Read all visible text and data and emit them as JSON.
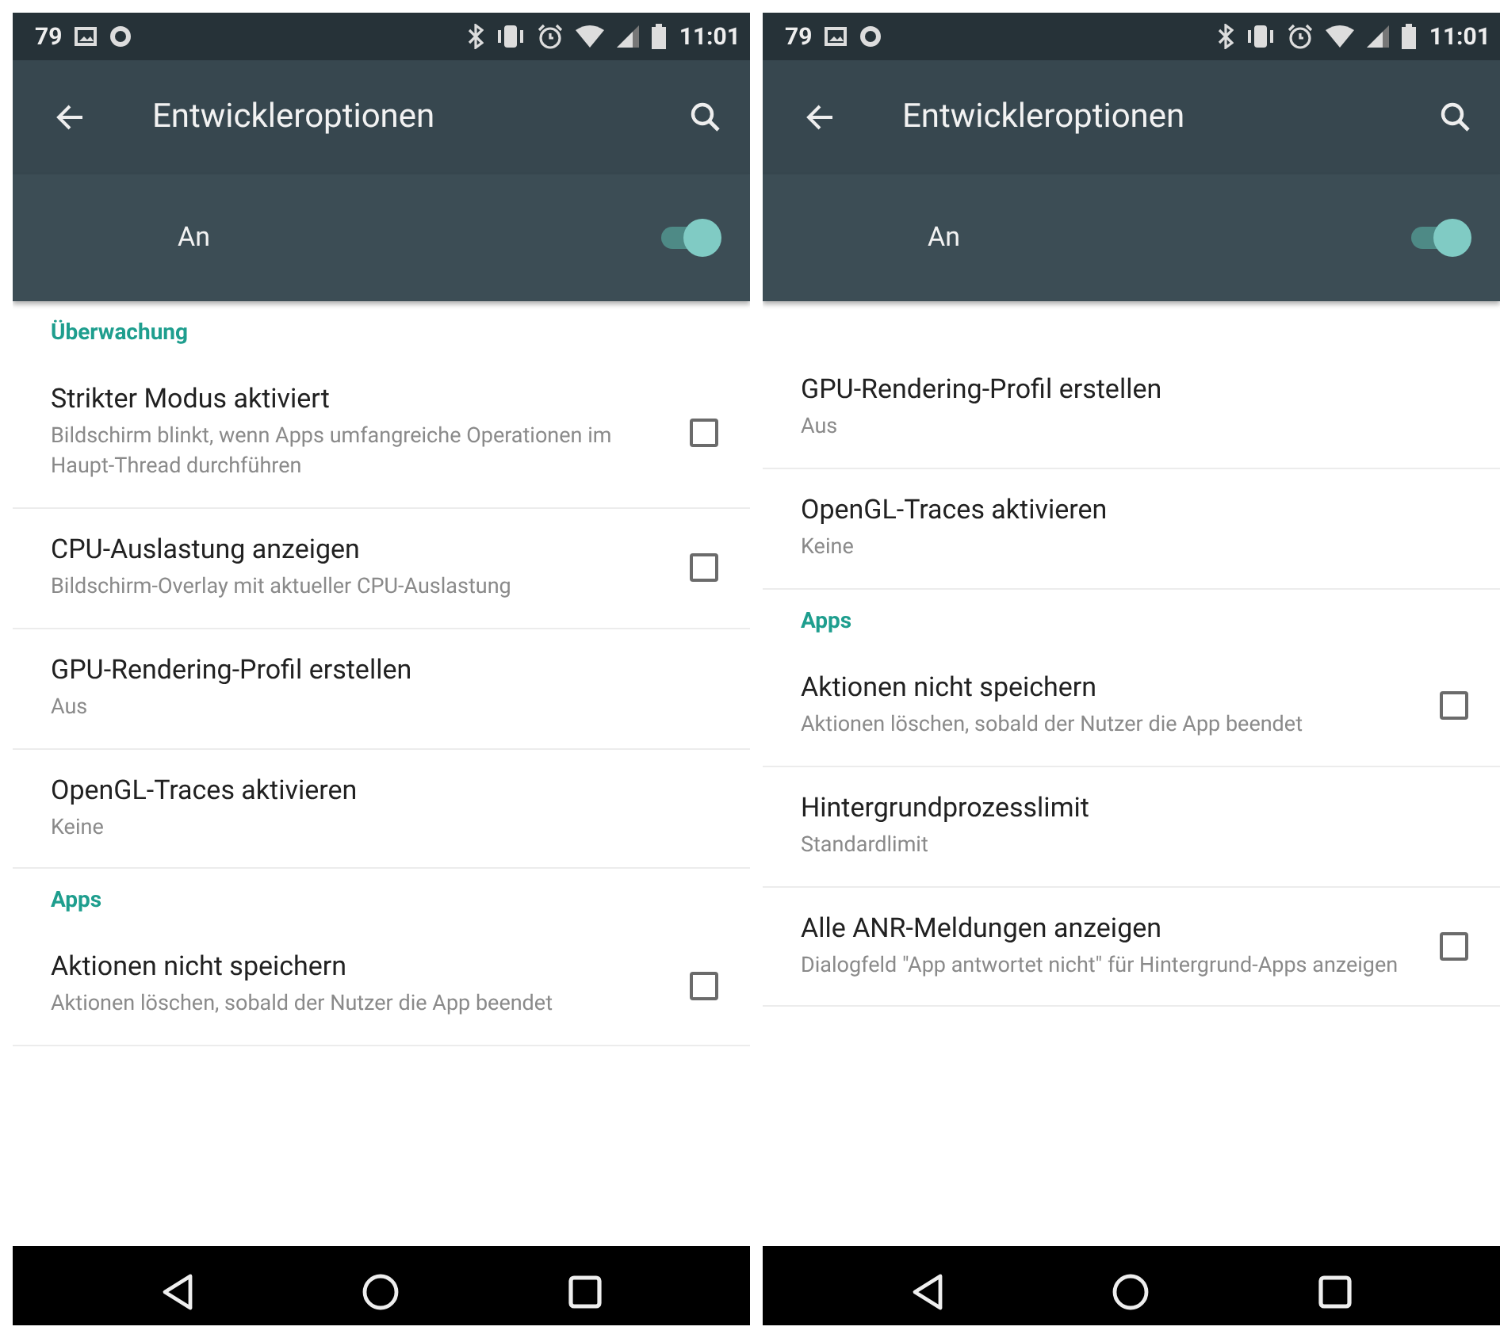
{
  "phones": [
    {
      "status_bar": {
        "left_text": "79",
        "time": "11:01"
      },
      "toolbar": {
        "title": "Entwickleroptionen"
      },
      "master_switch": {
        "label": "An",
        "on": true
      },
      "list": [
        {
          "kind": "header",
          "title": "Überwachung"
        },
        {
          "kind": "checkbox",
          "title": "Strikter Modus aktiviert",
          "summary": "Bildschirm blinkt, wenn Apps umfangreiche Operationen im Haupt-Thread durchführen",
          "checked": false
        },
        {
          "kind": "checkbox",
          "title": "CPU-Auslastung anzeigen",
          "summary": "Bildschirm-Overlay mit aktueller CPU-Auslastung",
          "checked": false
        },
        {
          "kind": "value",
          "title": "GPU-Rendering-Profil erstellen",
          "summary": "Aus"
        },
        {
          "kind": "value",
          "title": "OpenGL-Traces aktivieren",
          "summary": "Keine"
        },
        {
          "kind": "header",
          "title": "Apps"
        },
        {
          "kind": "checkbox",
          "title": "Aktionen nicht speichern",
          "summary": "Aktionen löschen, sobald der Nutzer die App beendet",
          "checked": false
        }
      ]
    },
    {
      "status_bar": {
        "left_text": "79",
        "time": "11:01"
      },
      "toolbar": {
        "title": "Entwickleroptionen"
      },
      "master_switch": {
        "label": "An",
        "on": true
      },
      "list": [
        {
          "kind": "value",
          "title": "GPU-Rendering-Profil erstellen",
          "summary": "Aus"
        },
        {
          "kind": "value",
          "title": "OpenGL-Traces aktivieren",
          "summary": "Keine"
        },
        {
          "kind": "header",
          "title": "Apps"
        },
        {
          "kind": "checkbox",
          "title": "Aktionen nicht speichern",
          "summary": "Aktionen löschen, sobald der Nutzer die App beendet",
          "checked": false
        },
        {
          "kind": "value",
          "title": "Hintergrundprozesslimit",
          "summary": "Standardlimit"
        },
        {
          "kind": "checkbox",
          "title": "Alle ANR-Meldungen anzeigen",
          "summary": "Dialogfeld \"App antwortet nicht\" für Hintergrund-Apps anzeigen",
          "checked": false
        }
      ]
    }
  ]
}
